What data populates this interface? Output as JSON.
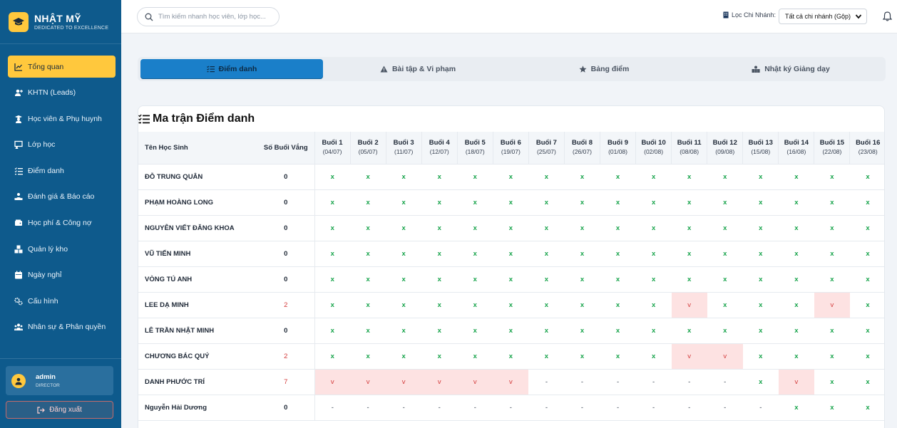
{
  "brand": {
    "name": "NHẬT MỸ",
    "tagline": "DEDICATED TO EXCELLENCE"
  },
  "nav": [
    {
      "label": "Tổng quan",
      "icon": "chart-line-icon",
      "active": true
    },
    {
      "label": "KHTN (Leads)",
      "icon": "user-plus-icon"
    },
    {
      "label": "Học viên & Phụ huynh",
      "icon": "student-icon"
    },
    {
      "label": "Lớp học",
      "icon": "chalkboard-icon"
    },
    {
      "label": "Điểm danh",
      "icon": "checklist-icon"
    },
    {
      "label": "Đánh giá & Báo cáo",
      "icon": "report-icon"
    },
    {
      "label": "Học phí & Công nợ",
      "icon": "wallet-icon"
    },
    {
      "label": "Quản lý kho",
      "icon": "boxes-icon"
    },
    {
      "label": "Ngày nghỉ",
      "icon": "calendar-icon"
    },
    {
      "label": "Cấu hình",
      "icon": "gears-icon"
    },
    {
      "label": "Nhân sự & Phân quyền",
      "icon": "users-icon"
    }
  ],
  "user": {
    "name": "admin",
    "role": "DIRECTOR"
  },
  "logout_label": "Đăng xuất",
  "search": {
    "placeholder": "Tìm kiếm nhanh học viên, lớp học..."
  },
  "filter": {
    "label": "Lọc Chi Nhánh:",
    "selected": "Tất cả chi nhánh (Gộp)"
  },
  "tabs": [
    {
      "label": "Điểm danh",
      "icon": "list-check-icon",
      "active": true
    },
    {
      "label": "Bài tập & Vi phạm",
      "icon": "warning-icon"
    },
    {
      "label": "Bảng điểm",
      "icon": "star-icon"
    },
    {
      "label": "Nhật ký Giảng dạy",
      "icon": "people-icon"
    }
  ],
  "matrix": {
    "title": "Ma trận Điểm danh",
    "col_name": "Tên Học Sinh",
    "col_absent": "Số Buổi Vắng",
    "sessions": [
      {
        "label": "Buổi 1",
        "date": "(04/07)"
      },
      {
        "label": "Buổi 2",
        "date": "(05/07)"
      },
      {
        "label": "Buổi 3",
        "date": "(11/07)"
      },
      {
        "label": "Buổi 4",
        "date": "(12/07)"
      },
      {
        "label": "Buổi 5",
        "date": "(18/07)"
      },
      {
        "label": "Buổi 6",
        "date": "(19/07)"
      },
      {
        "label": "Buổi 7",
        "date": "(25/07)"
      },
      {
        "label": "Buổi 8",
        "date": "(26/07)"
      },
      {
        "label": "Buổi 9",
        "date": "(01/08)"
      },
      {
        "label": "Buổi 10",
        "date": "(02/08)"
      },
      {
        "label": "Buổi 11",
        "date": "(08/08)"
      },
      {
        "label": "Buổi 12",
        "date": "(09/08)"
      },
      {
        "label": "Buổi 13",
        "date": "(15/08)"
      },
      {
        "label": "Buổi 14",
        "date": "(16/08)"
      },
      {
        "label": "Buổi 15",
        "date": "(22/08)"
      },
      {
        "label": "Buổi 16",
        "date": "(23/08)"
      }
    ],
    "rows": [
      {
        "name": "ĐỖ TRUNG QUÂN",
        "absent": "0",
        "marks": [
          "x",
          "x",
          "x",
          "x",
          "x",
          "x",
          "x",
          "x",
          "x",
          "x",
          "x",
          "x",
          "x",
          "x",
          "x",
          "x"
        ]
      },
      {
        "name": "PHẠM HOÀNG LONG",
        "absent": "0",
        "marks": [
          "x",
          "x",
          "x",
          "x",
          "x",
          "x",
          "x",
          "x",
          "x",
          "x",
          "x",
          "x",
          "x",
          "x",
          "x",
          "x"
        ]
      },
      {
        "name": "NGUYỄN VIẾT ĐĂNG KHOA",
        "absent": "0",
        "marks": [
          "x",
          "x",
          "x",
          "x",
          "x",
          "x",
          "x",
          "x",
          "x",
          "x",
          "x",
          "x",
          "x",
          "x",
          "x",
          "x"
        ]
      },
      {
        "name": "VŨ TIẾN MINH",
        "absent": "0",
        "marks": [
          "x",
          "x",
          "x",
          "x",
          "x",
          "x",
          "x",
          "x",
          "x",
          "x",
          "x",
          "x",
          "x",
          "x",
          "x",
          "x"
        ]
      },
      {
        "name": "VÒNG TÚ ANH",
        "absent": "0",
        "marks": [
          "x",
          "x",
          "x",
          "x",
          "x",
          "x",
          "x",
          "x",
          "x",
          "x",
          "x",
          "x",
          "x",
          "x",
          "x",
          "x"
        ]
      },
      {
        "name": "LEE DẠ MINH",
        "absent": "2",
        "marks": [
          "x",
          "x",
          "x",
          "x",
          "x",
          "x",
          "x",
          "x",
          "x",
          "x",
          "v",
          "x",
          "x",
          "x",
          "v",
          "x"
        ]
      },
      {
        "name": "LÊ TRẦN NHẬT MINH",
        "absent": "0",
        "marks": [
          "x",
          "x",
          "x",
          "x",
          "x",
          "x",
          "x",
          "x",
          "x",
          "x",
          "x",
          "x",
          "x",
          "x",
          "x",
          "x"
        ]
      },
      {
        "name": "CHƯƠNG BÁC QUÝ",
        "absent": "2",
        "marks": [
          "x",
          "x",
          "x",
          "x",
          "x",
          "x",
          "x",
          "x",
          "x",
          "x",
          "v",
          "v",
          "x",
          "x",
          "x",
          "x"
        ]
      },
      {
        "name": "DANH PHƯỚC TRÍ",
        "absent": "7",
        "marks": [
          "v",
          "v",
          "v",
          "v",
          "v",
          "v",
          "-",
          "-",
          "-",
          "-",
          "-",
          "-",
          "x",
          "v",
          "x",
          "x"
        ]
      },
      {
        "name": "Nguyễn Hải Dương",
        "absent": "0",
        "marks": [
          "-",
          "-",
          "-",
          "-",
          "-",
          "-",
          "-",
          "-",
          "-",
          "-",
          "-",
          "-",
          "-",
          "x",
          "x",
          "x"
        ]
      }
    ]
  }
}
